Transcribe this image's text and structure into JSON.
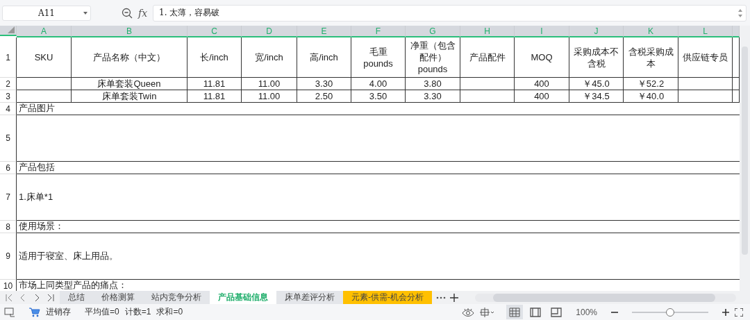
{
  "formula_bar": {
    "cell_ref": "A11",
    "fx": "fx",
    "formula": "1. 太薄，容易破"
  },
  "columns": [
    "A",
    "B",
    "C",
    "D",
    "E",
    "F",
    "G",
    "H",
    "I",
    "J",
    "K",
    "L"
  ],
  "header_row": {
    "number": "1",
    "cells": [
      "SKU",
      "产品名称（中文）",
      "长/inch",
      "宽/inch",
      "高/inch",
      "毛重 pounds",
      "净重（包含配件）pounds",
      "产品配件",
      "MOQ",
      "采购成本不含税",
      "含税采购成本",
      "供应链专员"
    ]
  },
  "rows": [
    {
      "number": "2",
      "cells": [
        null,
        "床单套装Queen",
        "11.81",
        "11.00",
        "3.30",
        "4.00",
        "3.80",
        null,
        "400",
        "￥45.0",
        "￥52.2",
        null
      ]
    },
    {
      "number": "3",
      "cells": [
        null,
        "床单套装Twin",
        "11.81",
        "11.00",
        "2.50",
        "3.50",
        "3.30",
        null,
        "400",
        "￥34.5",
        "￥40.0",
        null
      ]
    }
  ],
  "sections": [
    {
      "number": "4",
      "kind": "heading",
      "text": "产品图片"
    },
    {
      "number": "5",
      "kind": "body"
    },
    {
      "number": "6",
      "kind": "heading",
      "text": "产品包括"
    },
    {
      "number": "7",
      "kind": "body",
      "text": "1.床单*1"
    },
    {
      "number": "8",
      "kind": "heading",
      "text": "使用场景："
    },
    {
      "number": "9",
      "kind": "body",
      "text": "适用于寝室、床上用品。"
    },
    {
      "number": "10",
      "kind": "heading",
      "text": "市场上同类型产品的痛点："
    }
  ],
  "sheet_tabs": [
    {
      "label": "总结",
      "selected": false
    },
    {
      "label": "价格测算",
      "selected": false
    },
    {
      "label": "站内竞争分析",
      "selected": false
    },
    {
      "label": "产品基础信息",
      "selected": true
    },
    {
      "label": "床单差评分析",
      "selected": false
    },
    {
      "label": "元素-供需-机会分析",
      "selected": false,
      "color": "#ffc000"
    }
  ],
  "status_bar": {
    "app_label": "进销存",
    "average": "平均值=0",
    "count": "计数=1",
    "sum": "求和=0",
    "view_modes": [
      {
        "kind": "normal",
        "selected": true
      },
      {
        "kind": "page",
        "selected": false
      },
      {
        "kind": "break",
        "selected": false
      }
    ],
    "zoom": "100%",
    "zoom_slider": {
      "level": 0.5
    }
  }
}
